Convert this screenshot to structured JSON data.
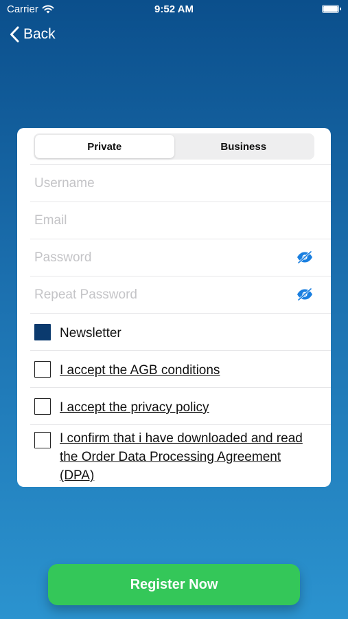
{
  "status_bar": {
    "carrier": "Carrier",
    "time": "9:52 AM",
    "icons": [
      "wifi-icon",
      "battery-icon"
    ]
  },
  "nav": {
    "back_label": "Back",
    "icon": "chevron-left-icon"
  },
  "segmented_control": {
    "options": [
      "Private",
      "Business"
    ],
    "selected": "Private"
  },
  "fields": {
    "username_placeholder": "Username",
    "email_placeholder": "Email",
    "password_placeholder": "Password",
    "repeat_password_placeholder": "Repeat Password",
    "visibility_icon": "eye-slash-icon"
  },
  "checkboxes": [
    {
      "label": "Newsletter",
      "checked": true,
      "link": false
    },
    {
      "label": "I accept the AGB conditions",
      "checked": false,
      "link": true
    },
    {
      "label": "I accept the privacy policy",
      "checked": false,
      "link": true
    },
    {
      "label": "I confirm that i have downloaded and read the Order Data Processing Agreement (DPA)",
      "checked": false,
      "link": true
    }
  ],
  "register_button": {
    "label": "Register Now"
  },
  "colors": {
    "background_top": "#0b4f8c",
    "background_bottom": "#2b93cf",
    "accent_blue": "#1a7fe0",
    "checked_box": "#0b3a6e",
    "register_green": "#34c759"
  }
}
